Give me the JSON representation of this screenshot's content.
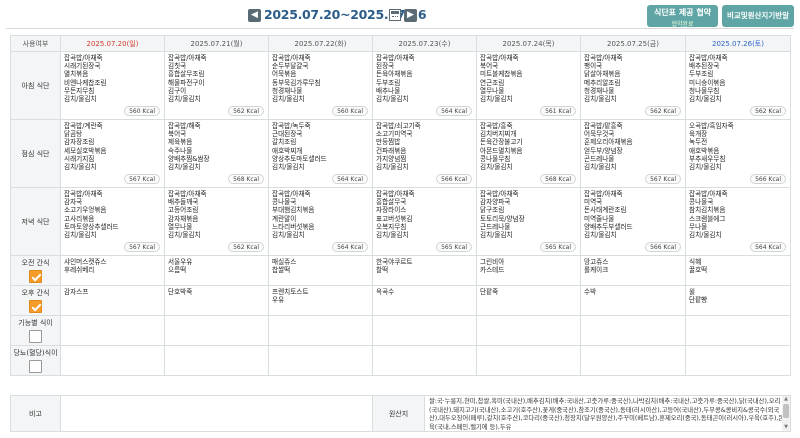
{
  "header": {
    "prev_icon": "triangle-left-icon",
    "week_range": "2025.07.20~2025.07.26",
    "calendar_icon": "calendar-icon",
    "next_icon": "triangle-right-icon",
    "agree_button": {
      "line1": "식단표 제공 협약",
      "line2": "협약완료"
    },
    "compare_button": "비교및원산지기반알"
  },
  "columns": {
    "row_header": "사용여부",
    "days": [
      "2025.07.20(일)",
      "2025.07.21(월)",
      "2025.07.22(화)",
      "2025.07.23(수)",
      "2025.07.24(목)",
      "2025.07.25(금)",
      "2025.07.26(토)"
    ]
  },
  "rows": {
    "breakfast": {
      "label": "아침 식단",
      "days": [
        {
          "items": [
            "잡곡밥/아채죽",
            "시래기된장국",
            "멸치볶음",
            "비엔나케찹조림",
            "무돈지무침",
            "김치/물김치"
          ],
          "kcal": "560 Kcal"
        },
        {
          "items": [
            "잡곡밥/아채죽",
            "김칫국",
            "흥합살무조림",
            "해물파전구이",
            "김구이",
            "김치/물김치"
          ],
          "kcal": "562 Kcal"
        },
        {
          "items": [
            "잡곡밥/아채죽",
            "순두부달걀국",
            "어묵볶음",
            "동부묵김가루무침",
            "청경채나물",
            "김치/물김치"
          ],
          "kcal": "560 Kcal"
        },
        {
          "items": [
            "잡곡밥/아채죽",
            "된장국",
            "돈육아채볶음",
            "두부조림",
            "배추나물",
            "김치/물김치"
          ],
          "kcal": "564 Kcal"
        },
        {
          "items": [
            "잡곡밥/아채죽",
            "북어국",
            "미트볼케찹볶음",
            "연근조림",
            "열무나물",
            "김치/물김치"
          ],
          "kcal": "561 Kcal"
        },
        {
          "items": [
            "잡곡밥/아채죽",
            "팽이국",
            "닭살아채볶음",
            "메추리알조림",
            "청경채나물",
            "김치/물김치"
          ],
          "kcal": "562 Kcal"
        },
        {
          "items": [
            "잡곡밥/아채죽",
            "배추된장국",
            "두부조림",
            "미니숭이볶음",
            "청나물무침",
            "김치/물김치"
          ],
          "kcal": "562 Kcal"
        }
      ]
    },
    "lunch": {
      "label": "점심 식단",
      "days": [
        {
          "items": [
            "잡곡밥/계란죽",
            "닭곰탕",
            "감자장조림",
            "세모실호박볶음",
            "시래기지짐",
            "김치/물김치"
          ],
          "kcal": "567 Kcal"
        },
        {
          "items": [
            "잡곡밥/해죽",
            "북어국",
            "제육볶음",
            "숙주나물",
            "양배추찜&쌈장",
            "김치/물김치"
          ],
          "kcal": "568 Kcal"
        },
        {
          "items": [
            "잡곡밥/녹두죽",
            "근대된장국",
            "갈치조림",
            "애호박찌개",
            "양상추토마토샐러드",
            "김치/물김치"
          ],
          "kcal": "564 Kcal"
        },
        {
          "items": [
            "잡곡밥/쇠고기죽",
            "소고기미역국",
            "만둥찜밥",
            "건파래볶음",
            "가지양념찜",
            "김치/물김치"
          ],
          "kcal": "566 Kcal"
        },
        {
          "items": [
            "잡곡밥/흥죽",
            "김치버지찌개",
            "돈육간장불고기",
            "아몬드멸치볶음",
            "콩나물무침",
            "김치/물김치"
          ],
          "kcal": "568 Kcal"
        },
        {
          "items": [
            "잡곡밥/팥흥죽",
            "어묵무것국",
            "훈제오리아채볶음",
            "얻두부/양념장",
            "곤드레나물",
            "김치/물김치"
          ],
          "kcal": "567 Kcal"
        },
        {
          "items": [
            "오곡밥/흑임자죽",
            "육개장",
            "녹두전",
            "애호박볶음",
            "부추새우무침",
            "김치/물김치"
          ],
          "kcal": "566 Kcal"
        }
      ]
    },
    "dinner": {
      "label": "저녁 식단",
      "days": [
        {
          "items": [
            "잡곡밥/아채죽",
            "감자국",
            "소고기우엉볶음",
            "고사리볶음",
            "토마토양상추샐러드",
            "김치/물김치"
          ],
          "kcal": "567 Kcal"
        },
        {
          "items": [
            "잡곡밥/아채죽",
            "배추들깨국",
            "고등어조림",
            "감자채볶음",
            "열무나물",
            "김치/물김치"
          ],
          "kcal": "562 Kcal"
        },
        {
          "items": [
            "잡곡밥/아채죽",
            "콩나물국",
            "부대햄김치볶음",
            "계란말이",
            "느타리버섯볶음",
            "김치/물김치"
          ],
          "kcal": "564 Kcal"
        },
        {
          "items": [
            "잡곡밥/아채죽",
            "흥합살무국",
            "자장라이스",
            "표고버섯볶김",
            "오복지무침",
            "김치/물김치"
          ],
          "kcal": "565 Kcal"
        },
        {
          "items": [
            "잡곡밥/아채죽",
            "감자양파국",
            "닭구조림",
            "토토리묵/양념장",
            "근드레나물",
            "김치/물김치"
          ],
          "kcal": "565 Kcal"
        },
        {
          "items": [
            "잡곡밥/아채죽",
            "미역국",
            "돈사태계란조림",
            "미역줄나물",
            "양배추두부샐러드",
            "김치/물김치"
          ],
          "kcal": "566 Kcal"
        },
        {
          "items": [
            "잡곡밥/아채죽",
            "콩나물국",
            "참치김치볶음",
            "스크램블에그",
            "무나물",
            "김치/물김치"
          ],
          "kcal": "564 Kcal"
        }
      ]
    },
    "am_snack": {
      "label": "오전 간식",
      "days": [
        [
          "샤인머스캣쥬스",
          "후레쉬베리"
        ],
        [
          "서울우유",
          "으름떡"
        ],
        [
          "매실쥬스",
          "찹쌀떡"
        ],
        [
          "한국야쿠르트",
          "찰떡"
        ],
        [
          "그린비아",
          "카스테드"
        ],
        [
          "망고쥬스",
          "롤케이크"
        ],
        [
          "식혜",
          "꿀호떡"
        ]
      ]
    },
    "pm_snack": {
      "label": "오후 간식",
      "days": [
        [
          "감자스프"
        ],
        [
          "단호박죽"
        ],
        [
          "프렌치토스트",
          "우유"
        ],
        [
          "옥곡수"
        ],
        [
          "단팥죽"
        ],
        [
          "수박"
        ],
        [
          "윌",
          "단팥빵"
        ]
      ]
    },
    "functional": {
      "label": "기능별 식이"
    },
    "diabetic": {
      "label": "당뇨(혈당)식이"
    }
  },
  "remarks": {
    "label": "비고",
    "value": "",
    "origin_label": "원산지",
    "origin_text": "쌀:국·누룽지,현미,찹쌀,흑미(국내산),배추김치(배추:국내산,고춧가루:중국산),나박김치(배추:국내산,고춧가루:중국산),닭(국내산),오리(국내산),돼지고기(국내산),소고기(호주산),꽃게(중국산),참조기(중국산),동태(러시아산),고등어(국내산),두부콩&콩비지&콩국수(외국산),대두오징어(페루),갈치(호주산),코다리(중국산),청장치(달우원양산),주꾸미(베트남),훈제오리(중국),동태곤이(러시아),우육(호주),돈육(국내,스페인,벨기에 등),두유"
  },
  "colors": {
    "accent_teal": "#5fa5a5",
    "checkbox_orange": "#f59b27",
    "title_blue": "#2c5d8a",
    "sunday_red": "#d23b2b",
    "saturday_blue": "#2c63c8"
  }
}
